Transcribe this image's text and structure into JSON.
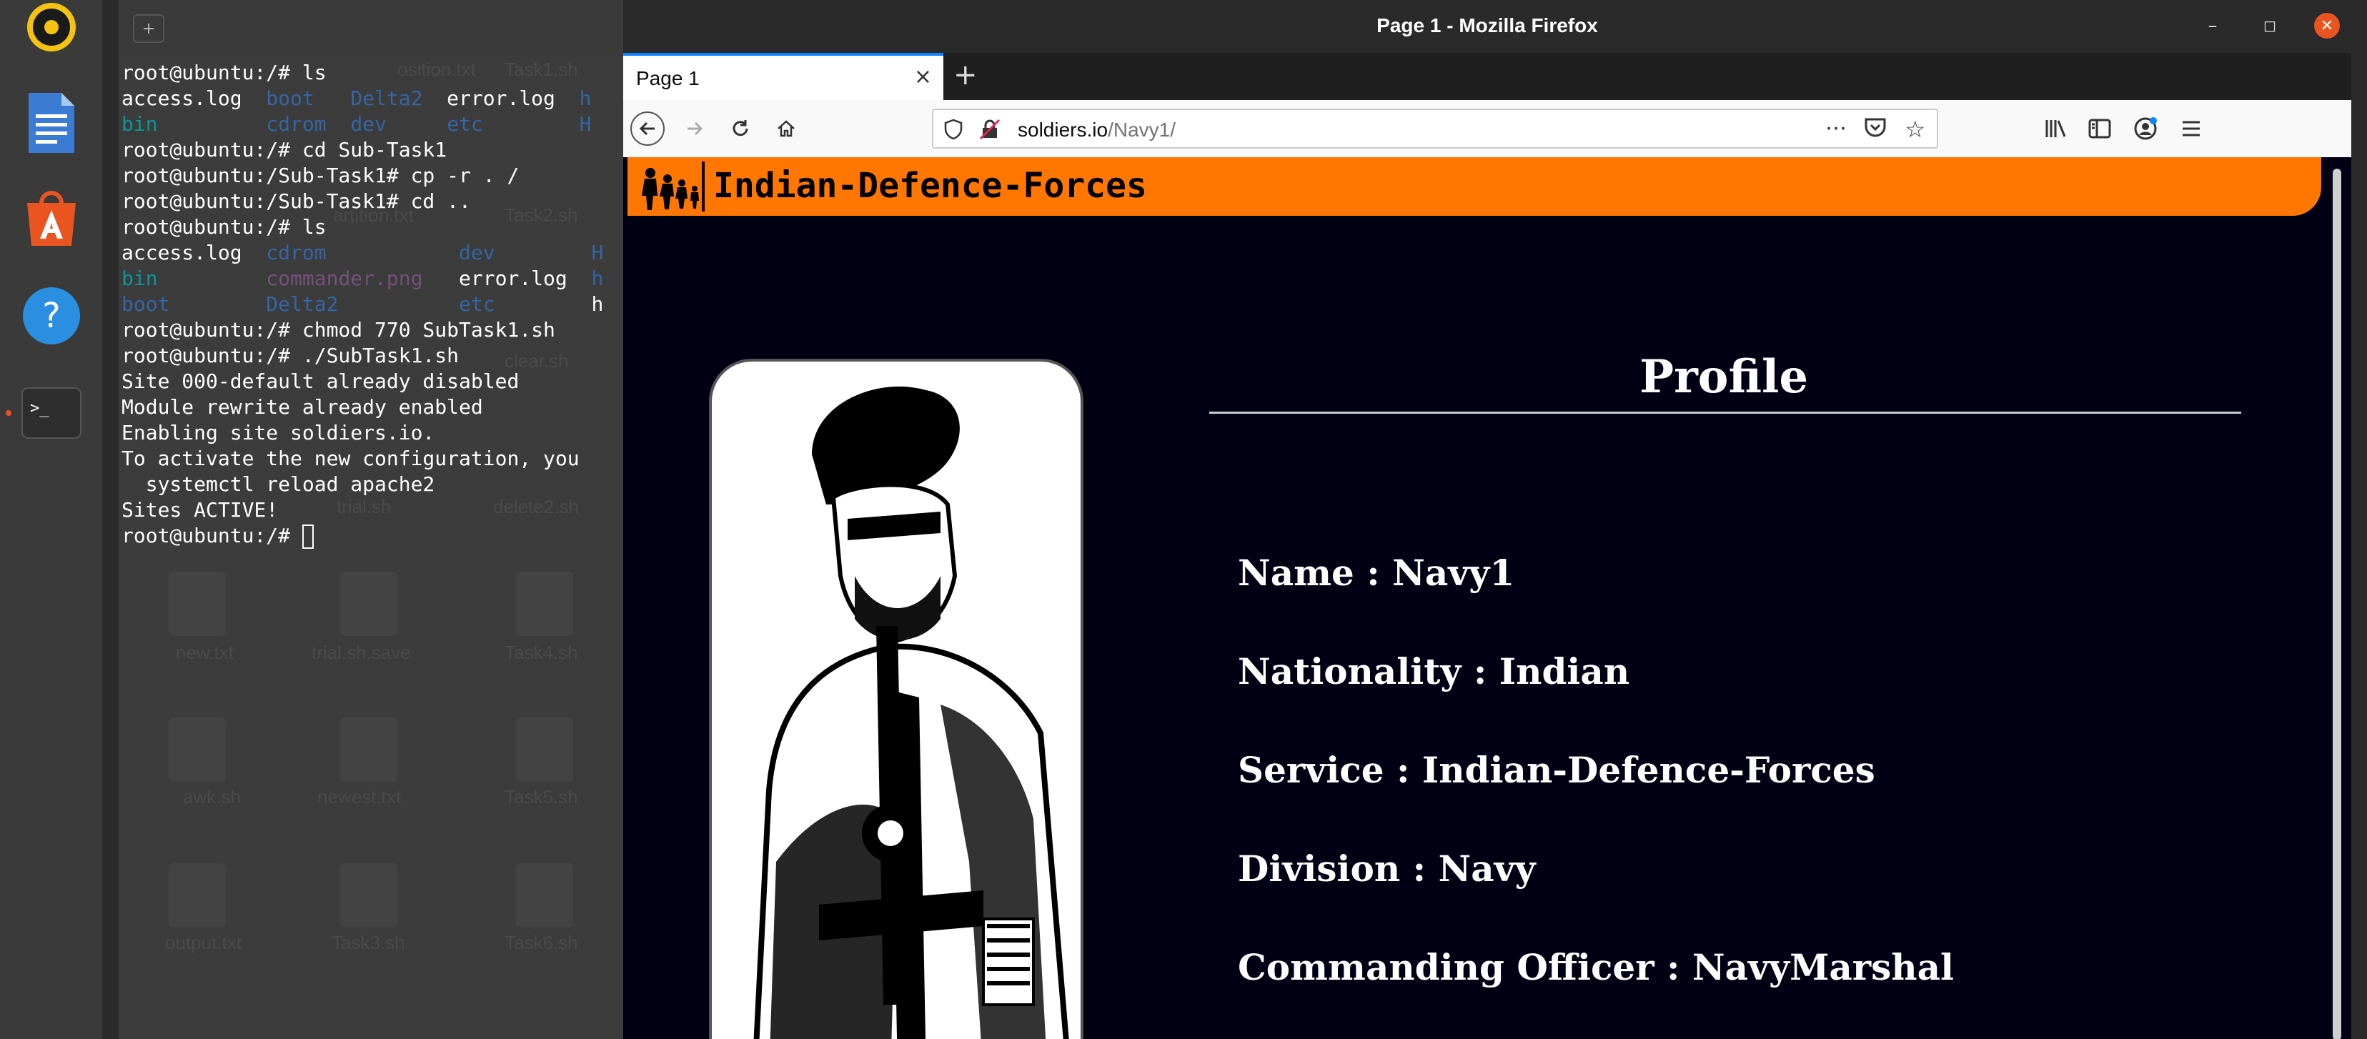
{
  "terminal": {
    "lines": [
      [
        "root@ubuntu:/# ls"
      ],
      [
        "access.log  ",
        {
          "t": "boot",
          "c": "blue"
        },
        "   ",
        {
          "t": "Delta2",
          "c": "blue"
        },
        "  error.log  ",
        {
          "t": "h",
          "c": "blue"
        }
      ],
      [
        {
          "t": "bin",
          "c": "teal"
        },
        "         ",
        {
          "t": "cdrom",
          "c": "blue"
        },
        "  ",
        {
          "t": "dev",
          "c": "blue"
        },
        "     ",
        {
          "t": "etc",
          "c": "blue"
        },
        "        ",
        {
          "t": "H",
          "c": "blue"
        }
      ],
      [
        "root@ubuntu:/# cd Sub-Task1"
      ],
      [
        "root@ubuntu:/Sub-Task1# cp -r . /"
      ],
      [
        "root@ubuntu:/Sub-Task1# cd .."
      ],
      [
        "root@ubuntu:/# ls"
      ],
      [
        "access.log  ",
        {
          "t": "cdrom",
          "c": "blue"
        },
        "           ",
        {
          "t": "dev",
          "c": "blue"
        },
        "        ",
        {
          "t": "H",
          "c": "blue"
        }
      ],
      [
        {
          "t": "bin",
          "c": "teal"
        },
        "         ",
        {
          "t": "commander.png",
          "c": "magenta"
        },
        "   error.log  ",
        {
          "t": "h",
          "c": "blue"
        }
      ],
      [
        {
          "t": "boot",
          "c": "blue"
        },
        "        ",
        {
          "t": "Delta2",
          "c": "blue"
        },
        "          ",
        {
          "t": "etc",
          "c": "blue"
        },
        "        h"
      ],
      [
        "root@ubuntu:/# chmod 770 SubTask1.sh"
      ],
      [
        "root@ubuntu:/# ./SubTask1.sh"
      ],
      [
        "Site 000-default already disabled"
      ],
      [
        "Module rewrite already enabled"
      ],
      [
        "Enabling site soldiers.io."
      ],
      [
        "To activate the new configuration, you"
      ],
      [
        "  systemctl reload apache2"
      ],
      [
        "Sites ACTIVE!"
      ],
      [
        "root@ubuntu:/# ",
        {
          "cursor": true
        }
      ]
    ]
  },
  "desktop_ghost": {
    "labels": [
      "osition.txt",
      "Task1.sh",
      "Task2.sh",
      "clear.sh",
      "trial.sh",
      "delete2.sh",
      "new.txt",
      "trial.sh.save",
      "Task4.sh",
      "awk.sh",
      "newest.txt",
      "Task5.sh",
      "output.txt",
      "Task3.sh",
      "Task6.sh",
      "artition.txt"
    ]
  },
  "firefox": {
    "window_title": "Page 1 - Mozilla Firefox",
    "tab_title": "Page 1",
    "url_domain": "soldiers.io",
    "url_path": "/Navy1/"
  },
  "page": {
    "site_title": "Indian-Defence-Forces",
    "profile_heading": "Profile",
    "fields": [
      {
        "label": "Name",
        "value": "Navy1"
      },
      {
        "label": "Nationality",
        "value": "Indian"
      },
      {
        "label": "Service",
        "value": "Indian-Defence-Forces"
      },
      {
        "label": "Division",
        "value": "Navy"
      },
      {
        "label": "Commanding Officer",
        "value": "NavyMarshal"
      }
    ]
  },
  "colors": {
    "header_orange": "#ff7700",
    "page_bg": "#000015",
    "ubuntu_orange": "#e95420"
  },
  "icons": [
    "rhythmbox-icon",
    "writer-icon",
    "software-center-icon",
    "help-icon",
    "terminal-icon"
  ]
}
